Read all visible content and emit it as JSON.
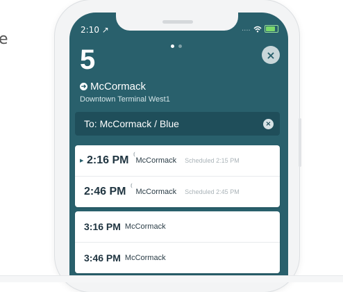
{
  "page_edge_text": "e",
  "status_bar": {
    "time": "2:10 ↗",
    "signal": "....",
    "wifi": "WiFi"
  },
  "header": {
    "route_number": "5",
    "destination": "McCormack",
    "stop_name": "Downtown Terminal West1",
    "close_label": "×"
  },
  "pager": {
    "count": 2,
    "active_index": 0
  },
  "filter": {
    "label": "To: McCormack / Blue",
    "clear_label": "×"
  },
  "departures_live": [
    {
      "time": "2:16 PM",
      "route": "McCormack",
      "scheduled": "Scheduled 2:15 PM",
      "active": true
    },
    {
      "time": "2:46 PM",
      "route": "McCormack",
      "scheduled": "Scheduled 2:45 PM",
      "active": false
    }
  ],
  "departures_scheduled": [
    {
      "time": "3:16 PM",
      "route": "McCormack"
    },
    {
      "time": "3:46 PM",
      "route": "McCormack"
    }
  ],
  "colors": {
    "teal": "#29606c",
    "filter_bg": "#1f4e5a",
    "card_bg": "#ffffff"
  }
}
